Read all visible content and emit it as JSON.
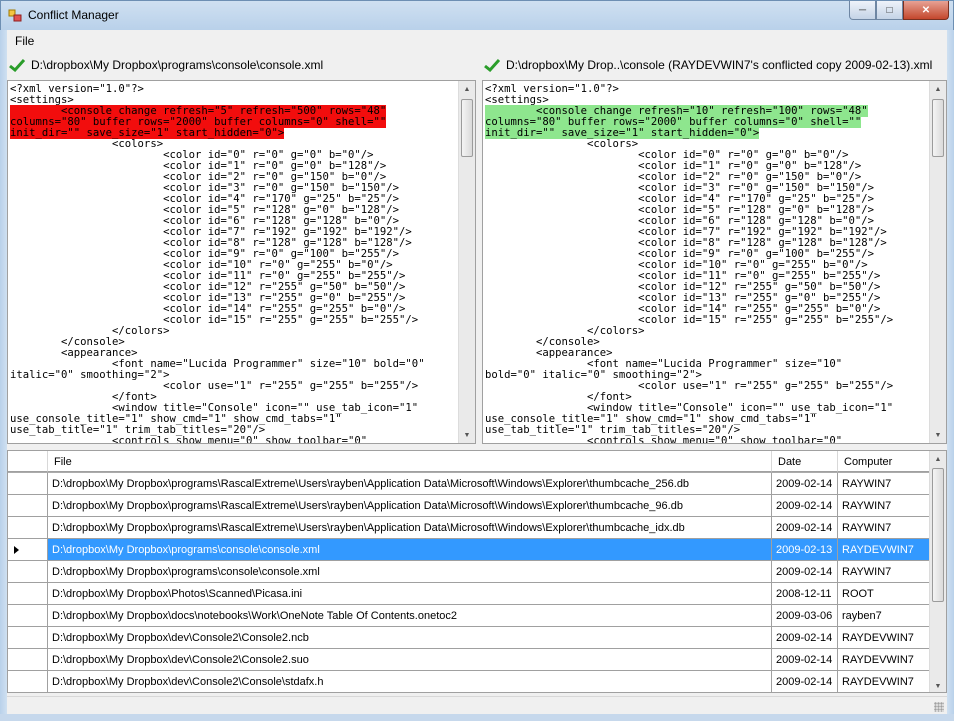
{
  "window": {
    "title": "Conflict Manager"
  },
  "menu": {
    "file": "File"
  },
  "left_pane": {
    "path": "D:\\dropbox\\My Dropbox\\programs\\console\\console.xml",
    "lines": [
      "<?xml version=\"1.0\"?>",
      "<settings>",
      {
        "hl": "        <console change_refresh=\"5\" refresh=\"500\" rows=\"48\"\ncolumns=\"80\" buffer_rows=\"2000\" buffer_columns=\"0\" shell=\"\"\ninit_dir=\"\" save_size=\"1\" start_hidden=\"0\">"
      },
      "                <colors>",
      "                        <color id=\"0\" r=\"0\" g=\"0\" b=\"0\"/>",
      "                        <color id=\"1\" r=\"0\" g=\"0\" b=\"128\"/>",
      "                        <color id=\"2\" r=\"0\" g=\"150\" b=\"0\"/>",
      "                        <color id=\"3\" r=\"0\" g=\"150\" b=\"150\"/>",
      "                        <color id=\"4\" r=\"170\" g=\"25\" b=\"25\"/>",
      "                        <color id=\"5\" r=\"128\" g=\"0\" b=\"128\"/>",
      "                        <color id=\"6\" r=\"128\" g=\"128\" b=\"0\"/>",
      "                        <color id=\"7\" r=\"192\" g=\"192\" b=\"192\"/>",
      "                        <color id=\"8\" r=\"128\" g=\"128\" b=\"128\"/>",
      "                        <color id=\"9\" r=\"0\" g=\"100\" b=\"255\"/>",
      "                        <color id=\"10\" r=\"0\" g=\"255\" b=\"0\"/>",
      "                        <color id=\"11\" r=\"0\" g=\"255\" b=\"255\"/>",
      "                        <color id=\"12\" r=\"255\" g=\"50\" b=\"50\"/>",
      "                        <color id=\"13\" r=\"255\" g=\"0\" b=\"255\"/>",
      "                        <color id=\"14\" r=\"255\" g=\"255\" b=\"0\"/>",
      "                        <color id=\"15\" r=\"255\" g=\"255\" b=\"255\"/>",
      "                </colors>",
      "        </console>",
      "        <appearance>",
      "                <font name=\"Lucida Programmer\" size=\"10\" bold=\"0\"",
      "italic=\"0\" smoothing=\"2\">",
      "                        <color use=\"1\" r=\"255\" g=\"255\" b=\"255\"/>",
      "                </font>",
      "                <window title=\"Console\" icon=\"\" use_tab_icon=\"1\"",
      "use_console_title=\"1\" show_cmd=\"1\" show_cmd_tabs=\"1\"",
      "use_tab_title=\"1\" trim_tab_titles=\"20\"/>",
      "                <controls show_menu=\"0\" show_toolbar=\"0\""
    ]
  },
  "right_pane": {
    "path": "D:\\dropbox\\My Drop..\\console (RAYDEVWIN7's conflicted copy 2009-02-13).xml",
    "lines": [
      "<?xml version=\"1.0\"?>",
      "<settings>",
      {
        "hl": "        <console change_refresh=\"10\" refresh=\"100\" rows=\"48\"\ncolumns=\"80\" buffer_rows=\"2000\" buffer_columns=\"0\" shell=\"\"\ninit_dir=\"\" save_size=\"1\" start_hidden=\"0\">"
      },
      "                <colors>",
      "                        <color id=\"0\" r=\"0\" g=\"0\" b=\"0\"/>",
      "                        <color id=\"1\" r=\"0\" g=\"0\" b=\"128\"/>",
      "                        <color id=\"2\" r=\"0\" g=\"150\" b=\"0\"/>",
      "                        <color id=\"3\" r=\"0\" g=\"150\" b=\"150\"/>",
      "                        <color id=\"4\" r=\"170\" g=\"25\" b=\"25\"/>",
      "                        <color id=\"5\" r=\"128\" g=\"0\" b=\"128\"/>",
      "                        <color id=\"6\" r=\"128\" g=\"128\" b=\"0\"/>",
      "                        <color id=\"7\" r=\"192\" g=\"192\" b=\"192\"/>",
      "                        <color id=\"8\" r=\"128\" g=\"128\" b=\"128\"/>",
      "                        <color id=\"9\" r=\"0\" g=\"100\" b=\"255\"/>",
      "                        <color id=\"10\" r=\"0\" g=\"255\" b=\"0\"/>",
      "                        <color id=\"11\" r=\"0\" g=\"255\" b=\"255\"/>",
      "                        <color id=\"12\" r=\"255\" g=\"50\" b=\"50\"/>",
      "                        <color id=\"13\" r=\"255\" g=\"0\" b=\"255\"/>",
      "                        <color id=\"14\" r=\"255\" g=\"255\" b=\"0\"/>",
      "                        <color id=\"15\" r=\"255\" g=\"255\" b=\"255\"/>",
      "                </colors>",
      "        </console>",
      "        <appearance>",
      "                <font name=\"Lucida Programmer\" size=\"10\"",
      "bold=\"0\" italic=\"0\" smoothing=\"2\">",
      "                        <color use=\"1\" r=\"255\" g=\"255\" b=\"255\"/>",
      "                </font>",
      "                <window title=\"Console\" icon=\"\" use_tab_icon=\"1\"",
      "use_console_title=\"1\" show_cmd=\"1\" show_cmd_tabs=\"1\"",
      "use_tab_title=\"1\" trim_tab_titles=\"20\"/>",
      "                <controls show_menu=\"0\" show_toolbar=\"0\""
    ]
  },
  "grid": {
    "columns": [
      "File",
      "Date",
      "Computer"
    ],
    "selected_row": 3,
    "rows": [
      [
        "D:\\dropbox\\My Dropbox\\programs\\RascalExtreme\\Users\\rayben\\Application Data\\Microsoft\\Windows\\Explorer\\thumbcache_256.db",
        "2009-02-14",
        "RAYWIN7"
      ],
      [
        "D:\\dropbox\\My Dropbox\\programs\\RascalExtreme\\Users\\rayben\\Application Data\\Microsoft\\Windows\\Explorer\\thumbcache_96.db",
        "2009-02-14",
        "RAYWIN7"
      ],
      [
        "D:\\dropbox\\My Dropbox\\programs\\RascalExtreme\\Users\\rayben\\Application Data\\Microsoft\\Windows\\Explorer\\thumbcache_idx.db",
        "2009-02-14",
        "RAYWIN7"
      ],
      [
        "D:\\dropbox\\My Dropbox\\programs\\console\\console.xml",
        "2009-02-13",
        "RAYDEVWIN7"
      ],
      [
        "D:\\dropbox\\My Dropbox\\programs\\console\\console.xml",
        "2009-02-14",
        "RAYWIN7"
      ],
      [
        "D:\\dropbox\\My Dropbox\\Photos\\Scanned\\Picasa.ini",
        "2008-12-11",
        "ROOT"
      ],
      [
        "D:\\dropbox\\My Dropbox\\docs\\notebooks\\Work\\OneNote Table Of Contents.onetoc2",
        "2009-03-06",
        "rayben7"
      ],
      [
        "D:\\dropbox\\My Dropbox\\dev\\Console2\\Console2.ncb",
        "2009-02-14",
        "RAYDEVWIN7"
      ],
      [
        "D:\\dropbox\\My Dropbox\\dev\\Console2\\Console2.suo",
        "2009-02-14",
        "RAYDEVWIN7"
      ],
      [
        "D:\\dropbox\\My Dropbox\\dev\\Console2\\Console\\stdafx.h",
        "2009-02-14",
        "RAYDEVWIN7"
      ]
    ]
  },
  "colors": {
    "left_highlight": "#f20d0d",
    "right_highlight": "#8ee68e",
    "selection": "#3399ff",
    "check": "#2a9d2a"
  },
  "icons": [
    "app-icon",
    "minimize-icon",
    "maximize-icon",
    "close-icon",
    "check-icon",
    "scroll-up-icon",
    "scroll-down-icon",
    "row-selector-icon",
    "size-grip-icon"
  ]
}
